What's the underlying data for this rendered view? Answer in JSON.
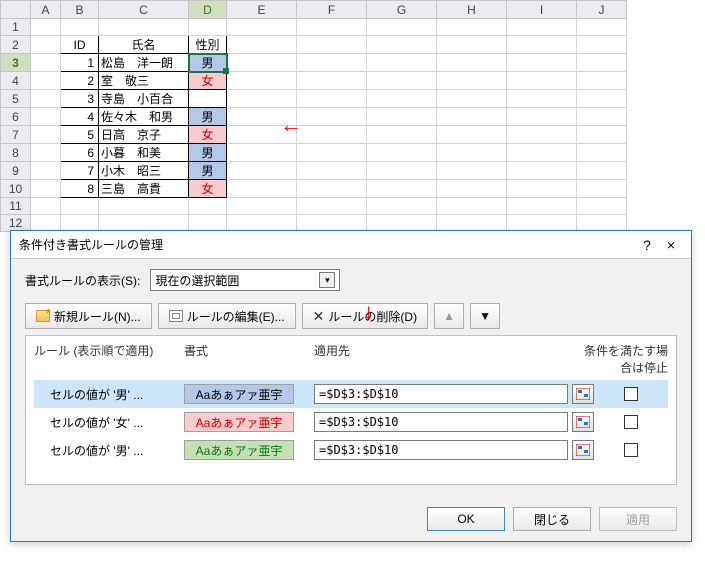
{
  "cols": [
    "A",
    "B",
    "C",
    "D",
    "E",
    "F",
    "G",
    "H",
    "I",
    "J"
  ],
  "rows": [
    "1",
    "2",
    "3",
    "4",
    "5",
    "6",
    "7",
    "8",
    "9",
    "10",
    "11",
    "12"
  ],
  "active_row": "3",
  "active_col": "D",
  "headers": {
    "id": "ID",
    "name": "氏名",
    "sex": "性別"
  },
  "data": [
    {
      "id": "1",
      "name": "松島　洋一朗",
      "sex": "男",
      "cls": "blue-bg"
    },
    {
      "id": "2",
      "name": "室　敬三",
      "sex": "女",
      "cls": "pink-bg"
    },
    {
      "id": "3",
      "name": "寺島　小百合",
      "sex": "",
      "cls": ""
    },
    {
      "id": "4",
      "name": "佐々木　和男",
      "sex": "男",
      "cls": "blue-bg"
    },
    {
      "id": "5",
      "name": "日高　京子",
      "sex": "女",
      "cls": "pink-bg"
    },
    {
      "id": "6",
      "name": "小暮　和美",
      "sex": "男",
      "cls": "blue-bg"
    },
    {
      "id": "7",
      "name": "小木　昭三",
      "sex": "男",
      "cls": "blue-bg"
    },
    {
      "id": "8",
      "name": "三島　高貴",
      "sex": "女",
      "cls": "pink-bg"
    }
  ],
  "dialog": {
    "title": "条件付き書式ルールの管理",
    "help": "?",
    "close": "×",
    "show_label": "書式ルールの表示(S):",
    "show_value": "現在の選択範囲",
    "btn_new": "新規ルール(N)...",
    "btn_edit": "ルールの編集(E)...",
    "btn_del": "ルールの削除(D)",
    "hdr_rule": "ルール (表示順で適用)",
    "hdr_fmt": "書式",
    "hdr_range": "適用先",
    "hdr_stop": "条件を満たす場合は停止",
    "preview_text": "Aaあぁアァ亜宇",
    "rules": [
      {
        "label": "セルの値が '男' ...",
        "cls": "prev-blue",
        "range": "=$D$3:$D$10",
        "sel": true
      },
      {
        "label": "セルの値が '女' ...",
        "cls": "prev-pink",
        "range": "=$D$3:$D$10",
        "sel": false
      },
      {
        "label": "セルの値が '男' ...",
        "cls": "prev-green",
        "range": "=$D$3:$D$10",
        "sel": false
      }
    ],
    "ok": "OK",
    "close_btn": "閉じる",
    "apply": "適用"
  }
}
